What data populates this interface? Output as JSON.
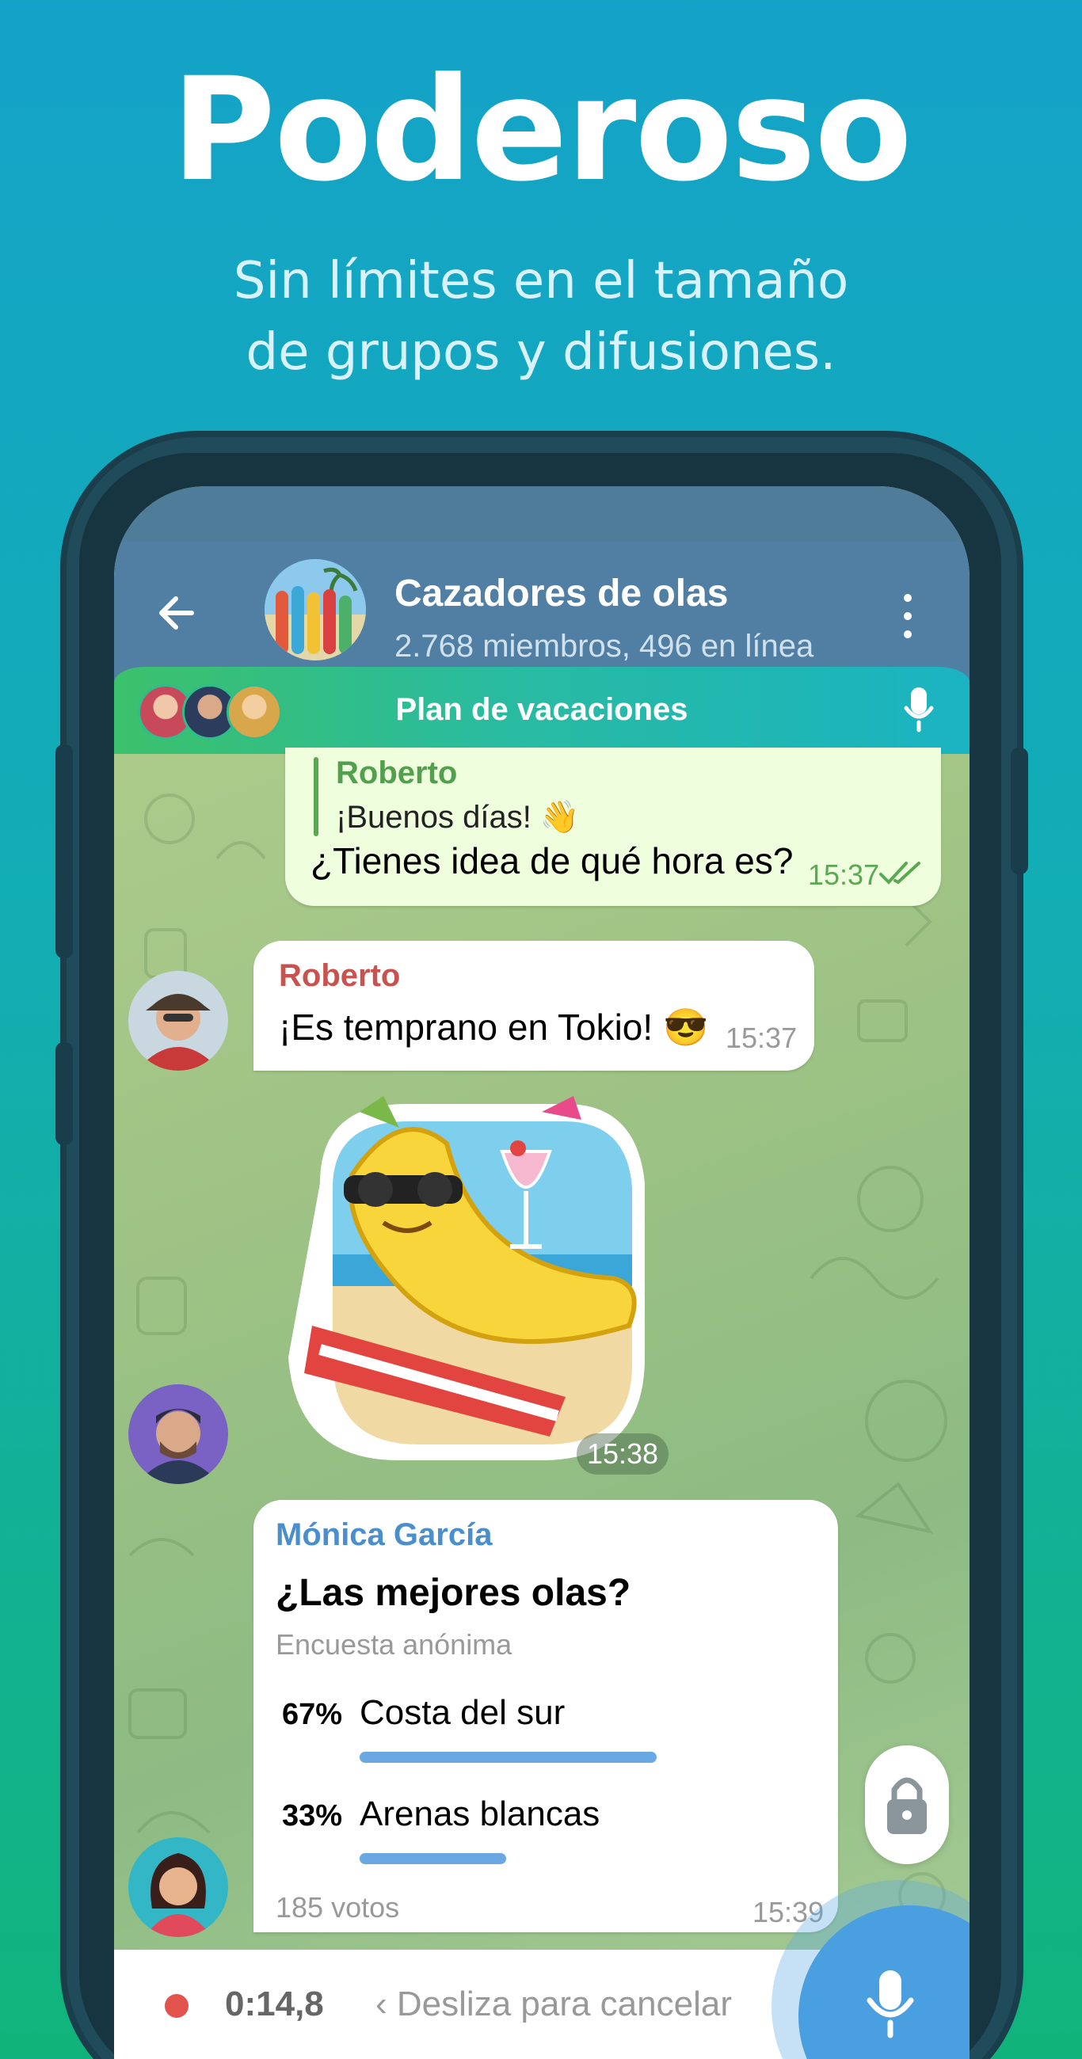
{
  "promo": {
    "headline": "Poderoso",
    "subline_1": "Sin límites en el tamaño",
    "subline_2": "de grupos y difusiones."
  },
  "chat_header": {
    "title": "Cazadores de olas",
    "subtitle": "2.768 miembros, 496 en línea",
    "back_icon": "arrow-left-icon",
    "more_icon": "more-vertical-icon"
  },
  "voice_chat": {
    "title": "Plan de vacaciones",
    "mic_icon": "microphone-icon"
  },
  "messages": {
    "outgoing": {
      "reply_name": "Roberto",
      "reply_text": "¡Buenos días! 👋",
      "text": "¿Tienes idea de qué hora es?",
      "time": "15:37",
      "status_icon": "double-check-icon"
    },
    "incoming_1": {
      "sender": "Roberto",
      "text": "¡Es temprano en Tokio! 😎",
      "time": "15:37"
    },
    "sticker": {
      "time": "15:38"
    },
    "poll": {
      "sender": "Mónica García",
      "question": "¿Las mejores olas?",
      "type": "Encuesta anónima",
      "options": [
        {
          "percent": "67%",
          "label": "Costa del sur",
          "share": 0.67
        },
        {
          "percent": "33%",
          "label": "Arenas blancas",
          "share": 0.33
        }
      ],
      "votes": "185 votos",
      "time": "15:39"
    }
  },
  "recording": {
    "elapsed": "0:14,8",
    "hint": "Desliza para cancelar",
    "lock_icon": "lock-icon",
    "mic_icon": "microphone-icon"
  },
  "colors": {
    "header": "#517fa3",
    "outgoing_bubble": "#effedd",
    "accent_green": "#52a04d",
    "roberto_name": "#c8534e",
    "monica_name": "#4a8fcc",
    "poll_bar": "#6aa8e4",
    "record_button": "#4a9fe0",
    "record_dot": "#e2534e"
  }
}
